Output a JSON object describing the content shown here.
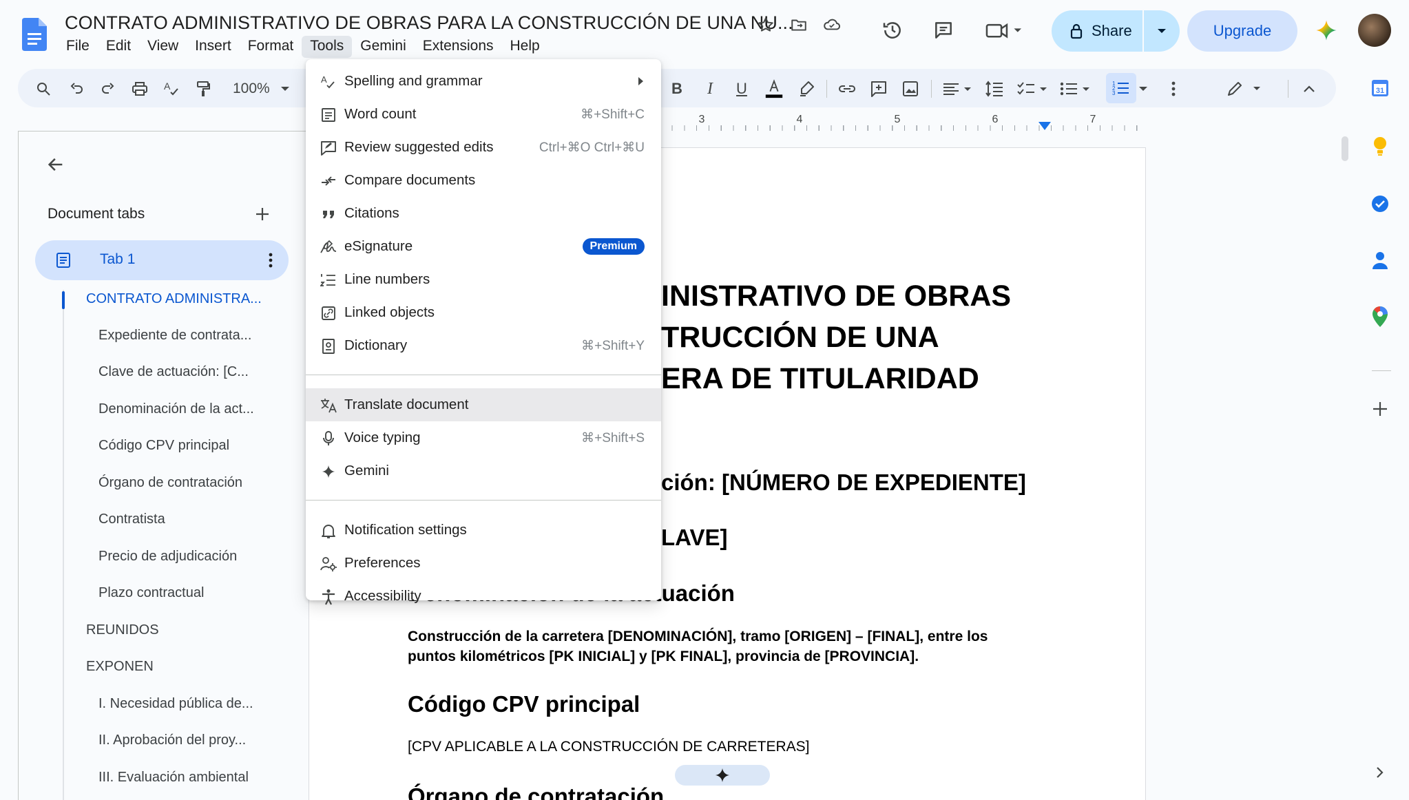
{
  "app": {
    "doc_title": "CONTRATO ADMINISTRATIVO DE OBRAS PARA LA CONSTRUCCIÓN DE UNA NU...",
    "menus": [
      "File",
      "Edit",
      "View",
      "Insert",
      "Format",
      "Tools",
      "Gemini",
      "Extensions",
      "Help"
    ],
    "active_menu": "Tools",
    "share_label": "Share",
    "upgrade_label": "Upgrade",
    "accent_color": "#0b57d0"
  },
  "toolbar": {
    "zoom": "100%"
  },
  "ruler": {
    "numbers": [
      "3",
      "4",
      "5",
      "6",
      "7"
    ]
  },
  "left_panel": {
    "heading": "Document tabs",
    "tab_label": "Tab 1",
    "outline": [
      {
        "label": "CONTRATO ADMINISTRA...",
        "level": 1,
        "active": true
      },
      {
        "label": "Expediente de contrata...",
        "level": 2
      },
      {
        "label": "Clave de actuación: [C...",
        "level": 2
      },
      {
        "label": "Denominación de la act...",
        "level": 2
      },
      {
        "label": "Código CPV principal",
        "level": 2
      },
      {
        "label": "Órgano de contratación",
        "level": 2
      },
      {
        "label": "Contratista",
        "level": 2
      },
      {
        "label": "Precio de adjudicación",
        "level": 2
      },
      {
        "label": "Plazo contractual",
        "level": 2
      },
      {
        "label": "REUNIDOS",
        "level": 1
      },
      {
        "label": "EXPONEN",
        "level": 1
      },
      {
        "label": "I. Necesidad pública de...",
        "level": 2
      },
      {
        "label": "II. Aprobación del proy...",
        "level": 2
      },
      {
        "label": "III. Evaluación ambiental",
        "level": 2
      }
    ]
  },
  "document": {
    "title_line1": "INISTRATIVO DE OBRAS",
    "title_line2": "TRUCCIÓN DE UNA",
    "title_line3": "ERA DE TITULARIDAD",
    "heading_expediente": "ción: [NÚMERO DE EXPEDIENTE]",
    "heading_clave": "LAVE]",
    "heading_denominacion": "Denominación de la actuación",
    "para_line1": "Construcción de la carretera [DENOMINACIÓN], tramo [ORIGEN] – [FINAL], entre los",
    "para_line2": "puntos kilométricos [PK INICIAL] y [PK FINAL], provincia de [PROVINCIA].",
    "heading_cpv": "Código CPV principal",
    "cpv_text": "[CPV APLICABLE A LA CONSTRUCCIÓN DE CARRETERAS]",
    "heading_organo": "Órgano de contratación"
  },
  "tools_menu": {
    "items": [
      {
        "label": "Spelling and grammar",
        "icon": "spellcheck-icon",
        "submenu": true
      },
      {
        "label": "Word count",
        "icon": "word-count-icon",
        "shortcut": "⌘+Shift+C"
      },
      {
        "label": "Review suggested edits",
        "icon": "review-edits-icon",
        "shortcut": "Ctrl+⌘O Ctrl+⌘U"
      },
      {
        "label": "Compare documents",
        "icon": "compare-icon"
      },
      {
        "label": "Citations",
        "icon": "quote-icon"
      },
      {
        "label": "eSignature",
        "icon": "signature-icon",
        "badge": "Premium"
      },
      {
        "label": "Line numbers",
        "icon": "line-numbers-icon"
      },
      {
        "label": "Linked objects",
        "icon": "linked-objects-icon"
      },
      {
        "label": "Dictionary",
        "icon": "dictionary-icon",
        "shortcut": "⌘+Shift+Y"
      },
      {
        "label": "Translate document",
        "icon": "translate-icon",
        "hovered": true
      },
      {
        "label": "Voice typing",
        "icon": "microphone-icon",
        "shortcut": "⌘+Shift+S"
      },
      {
        "label": "Gemini",
        "icon": "gemini-icon"
      },
      {
        "label": "Notification settings",
        "icon": "bell-icon"
      },
      {
        "label": "Preferences",
        "icon": "preferences-icon"
      },
      {
        "label": "Accessibility",
        "icon": "accessibility-icon"
      }
    ]
  }
}
